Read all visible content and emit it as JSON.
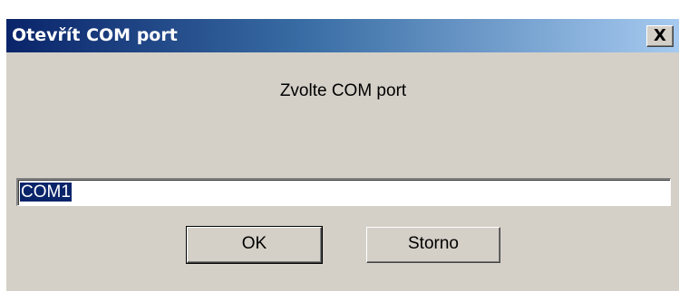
{
  "window": {
    "title": "Otevřít COM port",
    "close_label": "X"
  },
  "prompt": "Zvolte COM port",
  "input": {
    "value": "COM1"
  },
  "buttons": {
    "ok": "OK",
    "cancel": "Storno"
  },
  "colors": {
    "titlebar_start": "#0a246a",
    "titlebar_end": "#a6caf0",
    "dialog_bg": "#d4d0c8",
    "selection": "#0a246a"
  }
}
